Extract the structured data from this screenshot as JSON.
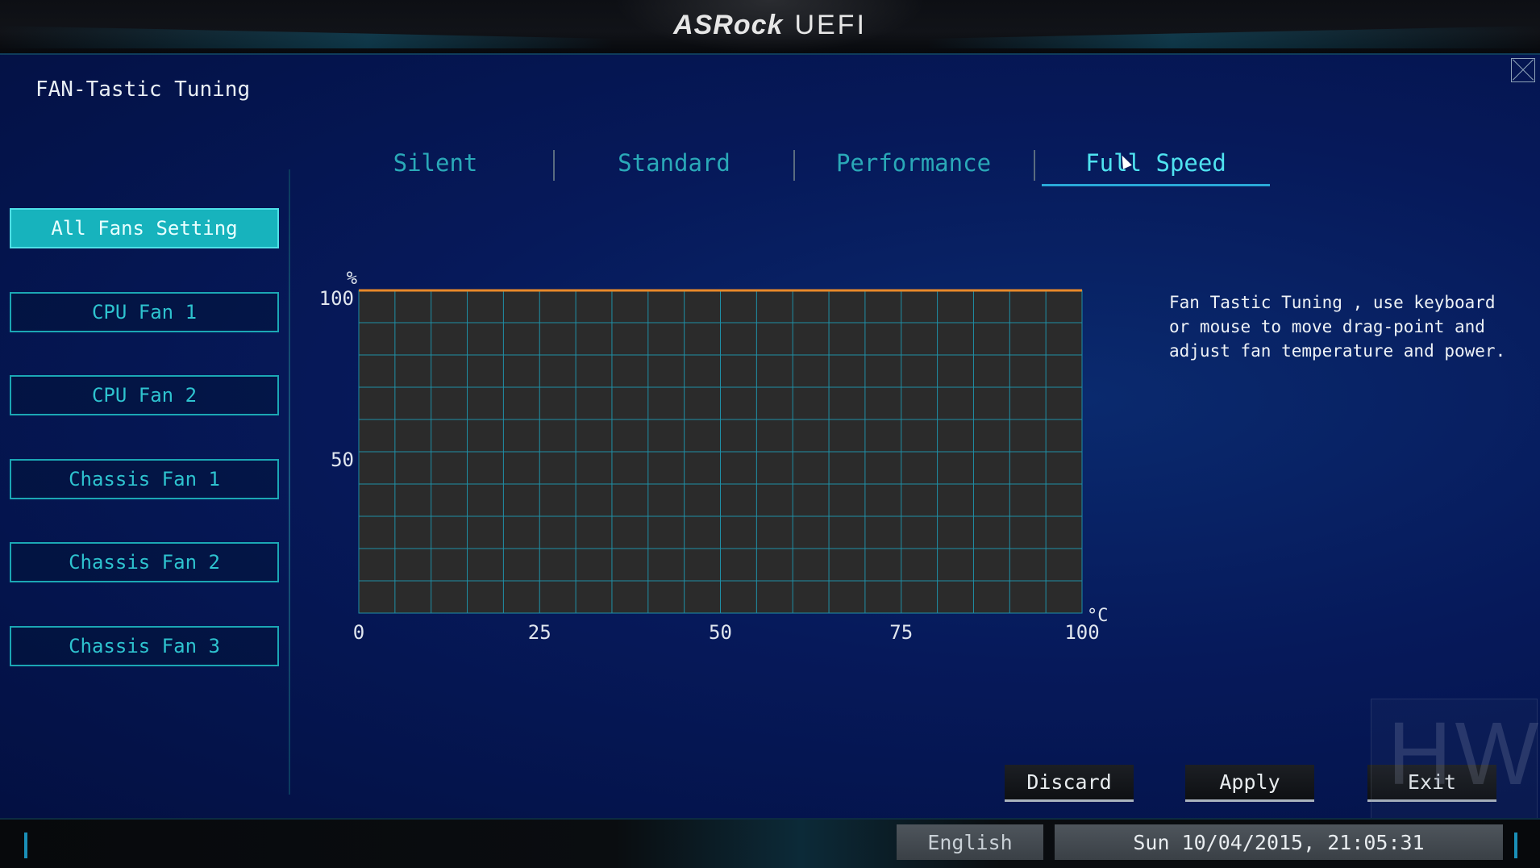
{
  "header": {
    "brand": "ASRock",
    "product": "UEFI"
  },
  "page": {
    "title": "FAN-Tastic Tuning"
  },
  "sidebar": {
    "items": [
      {
        "label": "All Fans Setting",
        "active": true
      },
      {
        "label": "CPU Fan 1",
        "active": false
      },
      {
        "label": "CPU Fan 2",
        "active": false
      },
      {
        "label": "Chassis Fan 1",
        "active": false
      },
      {
        "label": "Chassis Fan 2",
        "active": false
      },
      {
        "label": "Chassis Fan 3",
        "active": false
      }
    ]
  },
  "tabs": [
    {
      "label": "Silent",
      "active": false
    },
    {
      "label": "Standard",
      "active": false
    },
    {
      "label": "Performance",
      "active": false
    },
    {
      "label": "Full Speed",
      "active": true
    }
  ],
  "chart_data": {
    "type": "line",
    "title": "",
    "xlabel": "°C",
    "ylabel": "%",
    "xlim": [
      0,
      100
    ],
    "ylim": [
      0,
      100
    ],
    "x_ticks": [
      "0",
      "25",
      "50",
      "75",
      "100"
    ],
    "y_ticks": [
      "100",
      "50"
    ],
    "grid": true,
    "series": [
      {
        "x": [
          0,
          100
        ],
        "values": [
          100,
          100
        ],
        "color": "#e8892a"
      }
    ]
  },
  "help_text": "Fan Tastic Tuning , use keyboard\nor mouse to move drag-point and\nadjust fan temperature and power.",
  "actions": {
    "discard": "Discard",
    "apply": "Apply",
    "exit": "Exit"
  },
  "footer": {
    "language": "English",
    "datetime": "Sun 10/04/2015, 21:05:31"
  },
  "colors": {
    "accent": "#17b3bd",
    "tab_active": "#4fe3f0",
    "curve": "#e8892a",
    "grid": "#1f8fa6"
  },
  "icons": {
    "close": "close-icon",
    "cursor": "mouse-cursor-icon"
  }
}
